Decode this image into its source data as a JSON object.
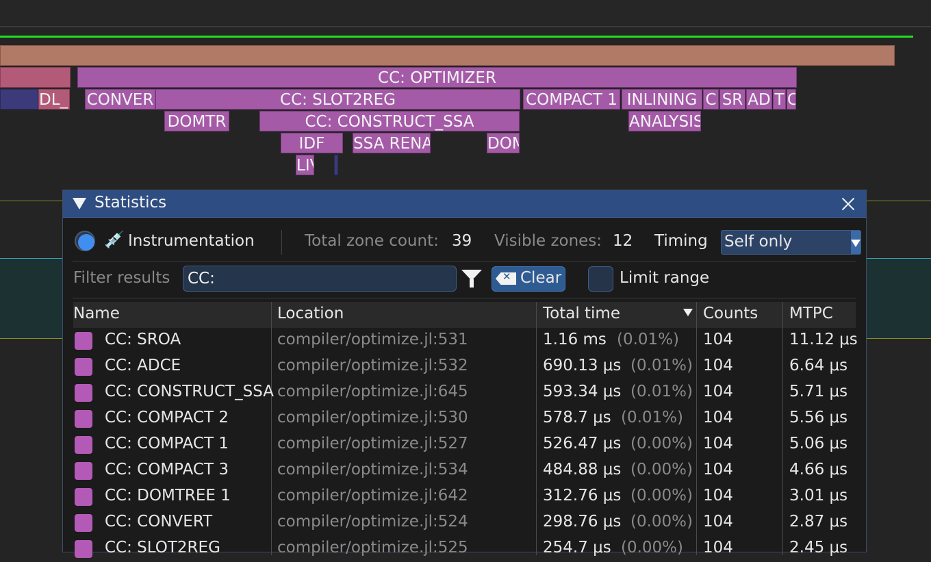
{
  "timeline": {
    "zones": [
      {
        "label": "",
        "style": "brown"
      },
      {
        "label": "",
        "style": "rose"
      },
      {
        "label": "CC: OPTIMIZER",
        "style": "pink"
      },
      {
        "label": "",
        "style": "blue"
      },
      {
        "label": "DL_(",
        "style": "rose"
      },
      {
        "label": "CONVER",
        "style": "pink"
      },
      {
        "label": "CC: SLOT2REG",
        "style": "pink"
      },
      {
        "label": "COMPACT 1",
        "style": "pink"
      },
      {
        "label": "INLINING",
        "style": "pink"
      },
      {
        "label": "C",
        "style": "pink"
      },
      {
        "label": "SR",
        "style": "pink"
      },
      {
        "label": "AD",
        "style": "pink"
      },
      {
        "label": "T",
        "style": "pink"
      },
      {
        "label": "C",
        "style": "pink"
      },
      {
        "label": "DOMTR",
        "style": "pink"
      },
      {
        "label": "CC: CONSTRUCT_SSA",
        "style": "pink"
      },
      {
        "label": "ANALYSIS",
        "style": "pink"
      },
      {
        "label": "IDF",
        "style": "pink"
      },
      {
        "label": "SSA RENA",
        "style": "pink"
      },
      {
        "label": "DOM",
        "style": "pink"
      },
      {
        "label": "LIV",
        "style": "pink"
      },
      {
        "label": "",
        "style": "blue"
      }
    ]
  },
  "stats": {
    "title": "Statistics",
    "mode_label": "Instrumentation",
    "total_zone_label": "Total zone count:",
    "total_zone_value": "39",
    "visible_zones_label": "Visible zones:",
    "visible_zones_value": "12",
    "timing_label": "Timing",
    "timing_value": "Self only",
    "filter_label": "Filter results",
    "filter_value": "CC:",
    "clear_label": "Clear",
    "limit_range_label": "Limit range",
    "columns": [
      "Name",
      "Location",
      "Total time",
      "Counts",
      "MTPC"
    ],
    "rows": [
      {
        "name": "CC: SROA",
        "location": "compiler/optimize.jl:531",
        "time": "1.16 ms",
        "pct": "(0.01%)",
        "counts": "104",
        "mtpc": "11.12 μs"
      },
      {
        "name": "CC: ADCE",
        "location": "compiler/optimize.jl:532",
        "time": "690.13 μs",
        "pct": "(0.01%)",
        "counts": "104",
        "mtpc": "6.64 μs"
      },
      {
        "name": "CC: CONSTRUCT_SSA",
        "location": "compiler/optimize.jl:645",
        "time": "593.34 μs",
        "pct": "(0.01%)",
        "counts": "104",
        "mtpc": "5.71 μs"
      },
      {
        "name": "CC: COMPACT 2",
        "location": "compiler/optimize.jl:530",
        "time": "578.7 μs",
        "pct": "(0.01%)",
        "counts": "104",
        "mtpc": "5.56 μs"
      },
      {
        "name": "CC: COMPACT 1",
        "location": "compiler/optimize.jl:527",
        "time": "526.47 μs",
        "pct": "(0.00%)",
        "counts": "104",
        "mtpc": "5.06 μs"
      },
      {
        "name": "CC: COMPACT 3",
        "location": "compiler/optimize.jl:534",
        "time": "484.88 μs",
        "pct": "(0.00%)",
        "counts": "104",
        "mtpc": "4.66 μs"
      },
      {
        "name": "CC: DOMTREE 1",
        "location": "compiler/optimize.jl:642",
        "time": "312.76 μs",
        "pct": "(0.00%)",
        "counts": "104",
        "mtpc": "3.01 μs"
      },
      {
        "name": "CC: CONVERT",
        "location": "compiler/optimize.jl:524",
        "time": "298.76 μs",
        "pct": "(0.00%)",
        "counts": "104",
        "mtpc": "2.87 μs"
      },
      {
        "name": "CC: SLOT2REG",
        "location": "compiler/optimize.jl:525",
        "time": "254.7 μs",
        "pct": "(0.00%)",
        "counts": "104",
        "mtpc": "2.45 μs"
      }
    ]
  },
  "colors": {
    "accent": "#2e4d82",
    "zone": "#a55aa8",
    "green_line": "#1ee01e"
  }
}
